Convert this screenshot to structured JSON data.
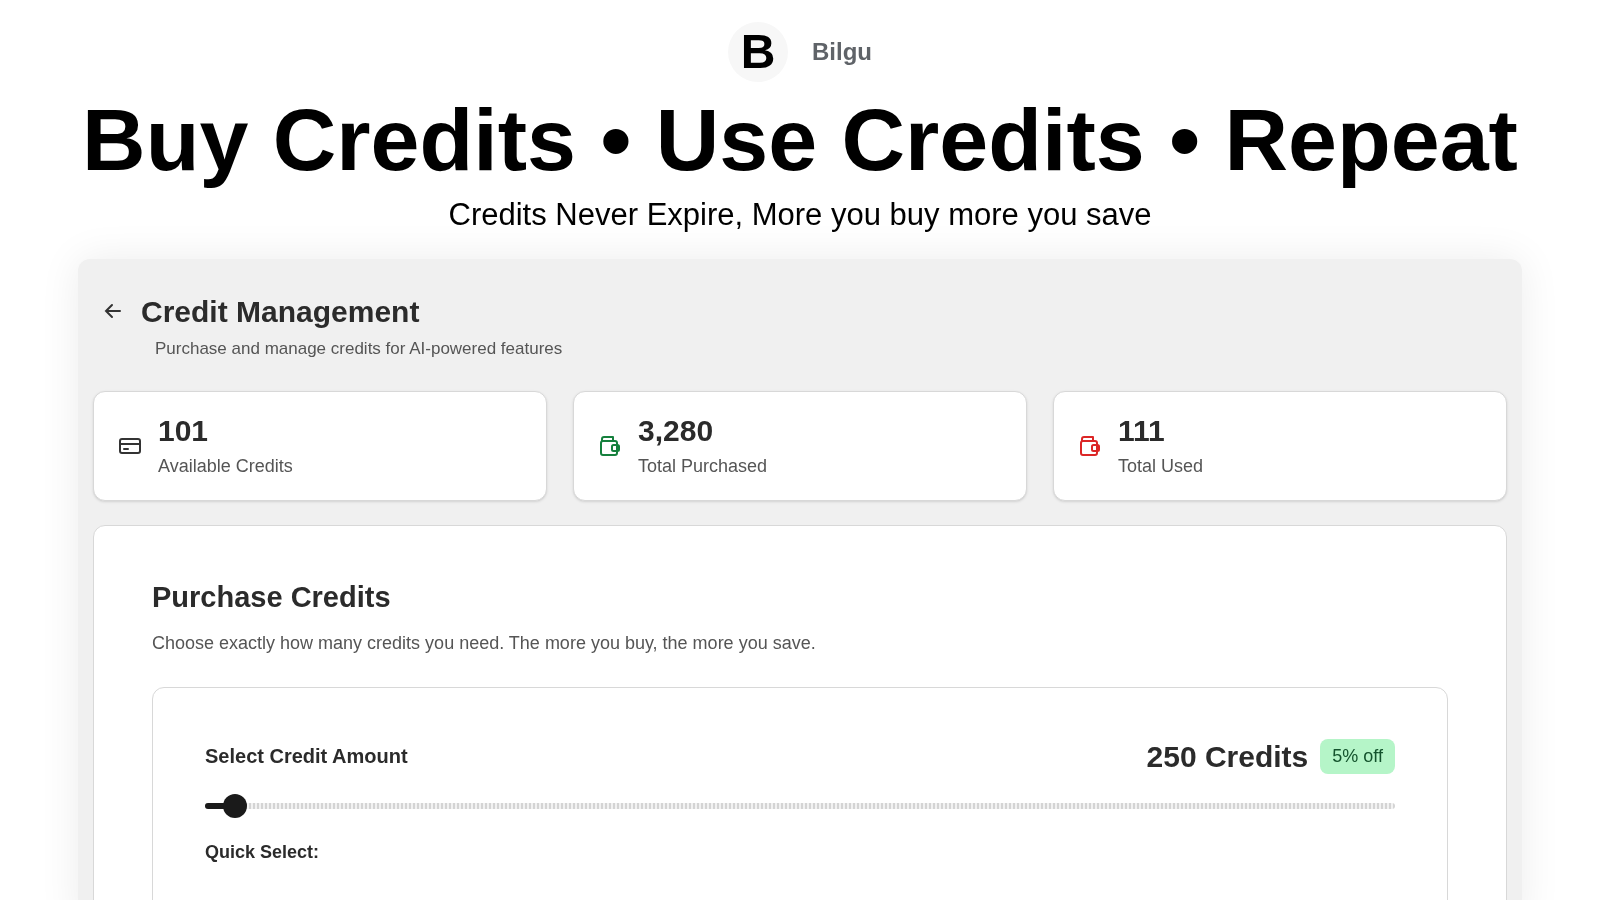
{
  "brand": {
    "logo": "B",
    "name": "Bilgu"
  },
  "hero": {
    "title": "Buy Credits • Use Credits • Repeat",
    "subtitle": "Credits Never Expire, More you buy more you save"
  },
  "page": {
    "title": "Credit Management",
    "description": "Purchase and manage credits for AI-powered features"
  },
  "stats": [
    {
      "kind": "card",
      "value": "101",
      "label": "Available Credits",
      "color": "#333333"
    },
    {
      "kind": "wallet",
      "value": "3,280",
      "label": "Total Purchased",
      "color": "#15803d"
    },
    {
      "kind": "wallet",
      "value": "111",
      "label": "Total Used",
      "color": "#dc2626"
    }
  ],
  "purchase": {
    "title": "Purchase Credits",
    "description": "Choose exactly how many credits you need. The more you buy, the more you save.",
    "selector": {
      "label": "Select Credit Amount",
      "amount": "250 Credits",
      "discount": "5% off",
      "level": 0.025,
      "quick_select_label": "Quick Select:"
    }
  }
}
